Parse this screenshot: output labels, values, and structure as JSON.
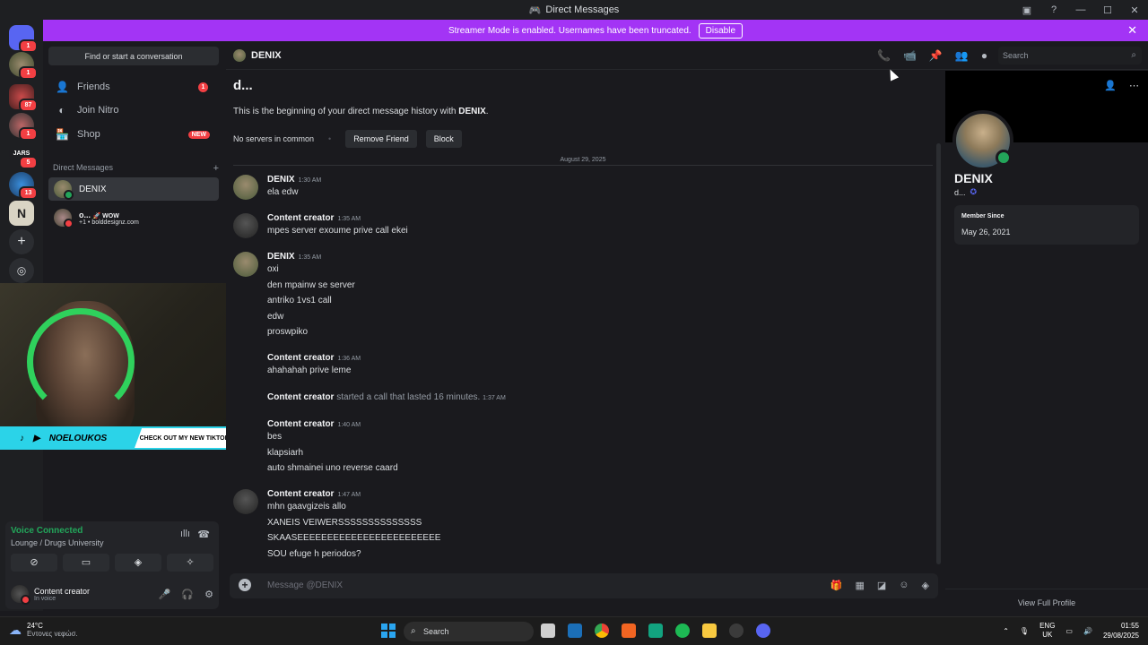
{
  "window": {
    "title": "Direct Messages"
  },
  "banner": {
    "text": "Streamer Mode is enabled. Usernames have been truncated.",
    "disable_label": "Disable"
  },
  "servers": [
    {
      "badge": "1"
    },
    {
      "badge": "1"
    },
    {
      "badge": "87"
    },
    {
      "badge": "1"
    },
    {
      "badge": "5",
      "label": "JARS"
    },
    {
      "badge": "13"
    },
    {
      "badge": ""
    }
  ],
  "dm_sidebar": {
    "find_label": "Find or start a conversation",
    "nav": [
      {
        "label": "Friends",
        "badge": "1"
      },
      {
        "label": "Join Nitro"
      },
      {
        "label": "Shop",
        "badge": "NEW"
      }
    ],
    "header": "Direct Messages",
    "dms": [
      {
        "name": "DENIX"
      },
      {
        "name": "o...",
        "emoji_text": "🚀 WOW",
        "sub": "+1 • bolddesignz.com"
      }
    ]
  },
  "overlay": {
    "tiktok_name": "NOELOUKOS",
    "promo": "CHECK OUT MY NEW TIKTOK VIDEO"
  },
  "voice": {
    "status": "Voice Connected",
    "channel": "Lounge / Drugs University"
  },
  "user": {
    "name": "Content creator",
    "status": "In voice"
  },
  "chat_header": {
    "name": "DENIX",
    "search_placeholder": "Search"
  },
  "chat": {
    "intro_title": "d...",
    "intro_prefix": "This is the beginning of your direct message history with ",
    "intro_name": "DENIX",
    "intro_suffix": ".",
    "no_servers": "No servers in common",
    "remove_friend": "Remove Friend",
    "block": "Block",
    "date": "August 29, 2025",
    "groups": [
      {
        "author": "DENIX",
        "time": "1:30 AM",
        "lines": [
          "ela edw"
        ]
      },
      {
        "author": "Content creator",
        "time": "1:35 AM",
        "lines": [
          "mpes server exoume prive call  ekei"
        ]
      },
      {
        "author": "DENIX",
        "time": "1:35 AM",
        "lines": [
          "oxi",
          "den mpainw se server",
          "antriko 1vs1 call",
          "edw",
          "proswpiko"
        ]
      },
      {
        "author": "Content creator",
        "time": "1:36 AM",
        "lines": [
          "ahahahah prive leme"
        ]
      },
      {
        "author": "Content creator",
        "call_text": "started a call that lasted 16 minutes.",
        "time": "1:37 AM"
      },
      {
        "author": "Content creator",
        "time": "1:40 AM",
        "lines": [
          "bes",
          "klapsiarh",
          "auto shmainei uno reverse caard"
        ]
      },
      {
        "author": "Content creator",
        "time": "1:47 AM",
        "lines": [
          "mhn gaavgizeis allo",
          "XANEIS VEIWERSSSSSSSSSSSSSS",
          "SKAASEEEEEEEEEEEEEEEEEEEEEEEE",
          "SOU efuge h  periodos?"
        ]
      }
    ],
    "composer_placeholder": "Message @DENIX"
  },
  "profile": {
    "name": "DENIX",
    "username": "d...",
    "member_since_label": "Member Since",
    "member_since": "May 26, 2021",
    "view_full": "View Full Profile"
  },
  "taskbar": {
    "temp": "24°C",
    "weather": "Εντονες νεφώσ.",
    "search": "Search",
    "lang_1": "ENG",
    "lang_2": "UK",
    "time": "01:55",
    "date": "29/08/2025"
  },
  "colors": {
    "accent": "#5865f2",
    "banner": "#a334f5",
    "online": "#23a55a",
    "danger": "#f23f43"
  }
}
